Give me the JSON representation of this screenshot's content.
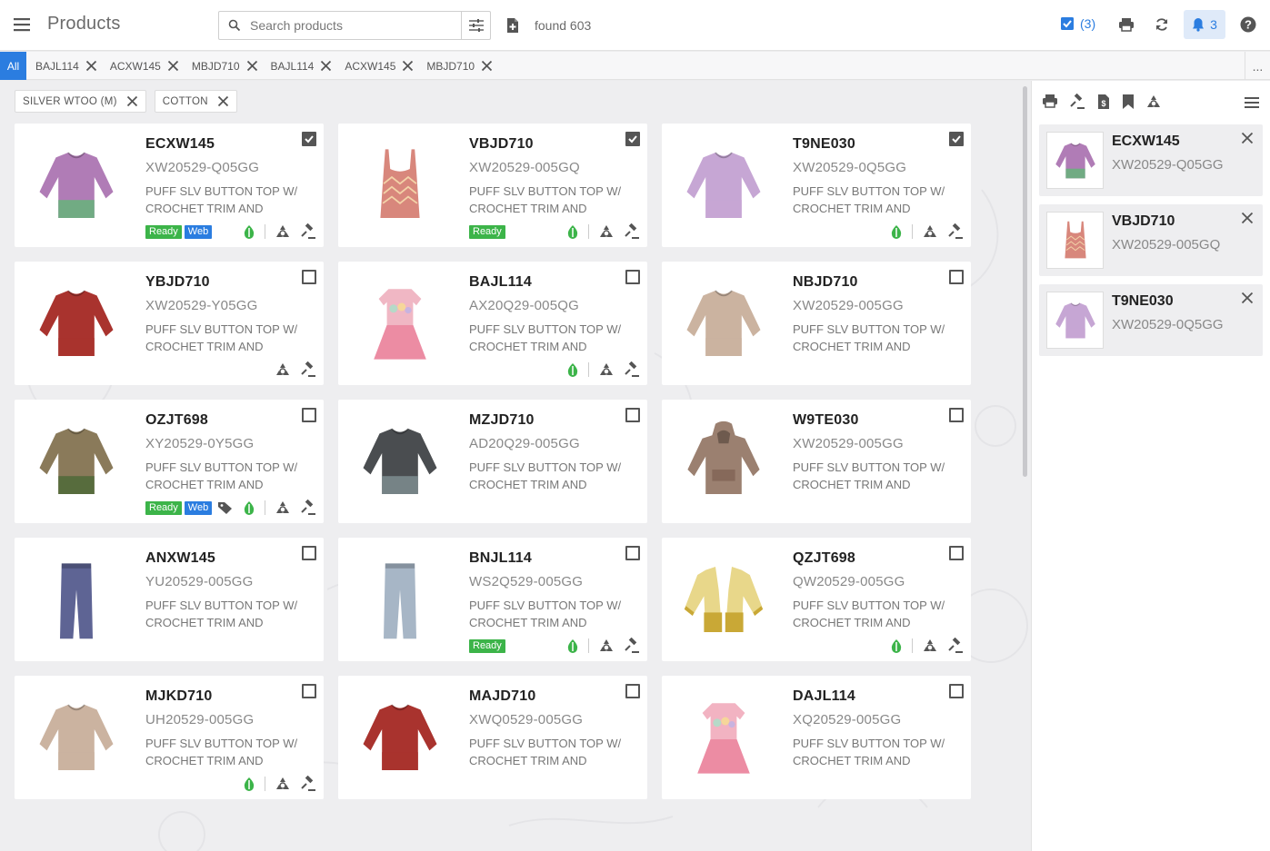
{
  "header": {
    "title": "Products",
    "search_placeholder": "Search products",
    "found_text": "found 603",
    "selected_count": "(3)",
    "notifications_count": "3"
  },
  "tabs": {
    "all_label": "All",
    "items": [
      "BAJL114",
      "ACXW145",
      "MBJD710",
      "BAJL114",
      "ACXW145",
      "MBJD710"
    ],
    "more_label": "..."
  },
  "filters": [
    "SILVER WTOO (M)",
    "COTTON"
  ],
  "products": [
    {
      "code": "ECXW145",
      "style": "XW20529-Q05GG",
      "desc": "PUFF SLV BUTTON TOP W/ CROCHET TRIM AND",
      "checked": true,
      "badges": [
        "Ready",
        "Web"
      ]
    },
    {
      "code": "VBJD710",
      "style": "XW20529-005GQ",
      "desc": "PUFF SLV BUTTON TOP W/ CROCHET TRIM AND",
      "checked": true,
      "badges": [
        "Ready"
      ]
    },
    {
      "code": "T9NE030",
      "style": "XW20529-0Q5GG",
      "desc": "PUFF SLV BUTTON TOP W/ CROCHET TRIM AND",
      "checked": true,
      "badges": []
    },
    {
      "code": "YBJD710",
      "style": "XW20529-Y05GG",
      "desc": "PUFF SLV BUTTON TOP W/ CROCHET TRIM AND",
      "checked": false,
      "badges": []
    },
    {
      "code": "BAJL114",
      "style": "AX20Q29-005QG",
      "desc": "PUFF SLV BUTTON TOP W/ CROCHET TRIM AND",
      "checked": false,
      "badges": []
    },
    {
      "code": "NBJD710",
      "style": "XW20529-005GG",
      "desc": "PUFF SLV BUTTON TOP W/ CROCHET TRIM AND",
      "checked": false,
      "badges": []
    },
    {
      "code": "OZJT698",
      "style": "XY20529-0Y5GG",
      "desc": "PUFF SLV BUTTON TOP W/ CROCHET TRIM AND",
      "checked": false,
      "badges": [
        "Ready",
        "Web"
      ]
    },
    {
      "code": "MZJD710",
      "style": "AD20Q29-005GG",
      "desc": "PUFF SLV BUTTON TOP W/ CROCHET TRIM AND",
      "checked": false,
      "badges": []
    },
    {
      "code": "W9TE030",
      "style": "XW20529-005GG",
      "desc": "PUFF SLV BUTTON TOP W/ CROCHET TRIM AND",
      "checked": false,
      "badges": []
    },
    {
      "code": "ANXW145",
      "style": "YU20529-005GG",
      "desc": "PUFF SLV BUTTON TOP W/ CROCHET TRIM AND",
      "checked": false,
      "badges": []
    },
    {
      "code": "BNJL114",
      "style": "WS2Q529-005GG",
      "desc": "PUFF SLV BUTTON TOP W/ CROCHET TRIM AND",
      "checked": false,
      "badges": [
        "Ready"
      ]
    },
    {
      "code": "QZJT698",
      "style": "QW20529-005GG",
      "desc": "PUFF SLV BUTTON TOP W/ CROCHET TRIM AND",
      "checked": false,
      "badges": []
    },
    {
      "code": "MJKD710",
      "style": "UH20529-005GG",
      "desc": "PUFF SLV BUTTON TOP W/ CROCHET TRIM AND",
      "checked": false,
      "badges": []
    },
    {
      "code": "MAJD710",
      "style": "XWQ0529-005GG",
      "desc": "PUFF SLV BUTTON TOP W/ CROCHET TRIM AND",
      "checked": false,
      "badges": []
    },
    {
      "code": "DAJL114",
      "style": "XQ20529-005GG",
      "desc": "PUFF SLV BUTTON TOP W/ CROCHET TRIM AND",
      "checked": false,
      "badges": []
    }
  ],
  "selected": [
    {
      "code": "ECXW145",
      "style": "XW20529-Q05GG"
    },
    {
      "code": "VBJD710",
      "style": "XW20529-005GQ"
    },
    {
      "code": "T9NE030",
      "style": "XW20529-0Q5GG"
    }
  ],
  "colors": {
    "accent": "#2b7de0",
    "ready": "#3cb449",
    "eco": "#3cb449"
  }
}
